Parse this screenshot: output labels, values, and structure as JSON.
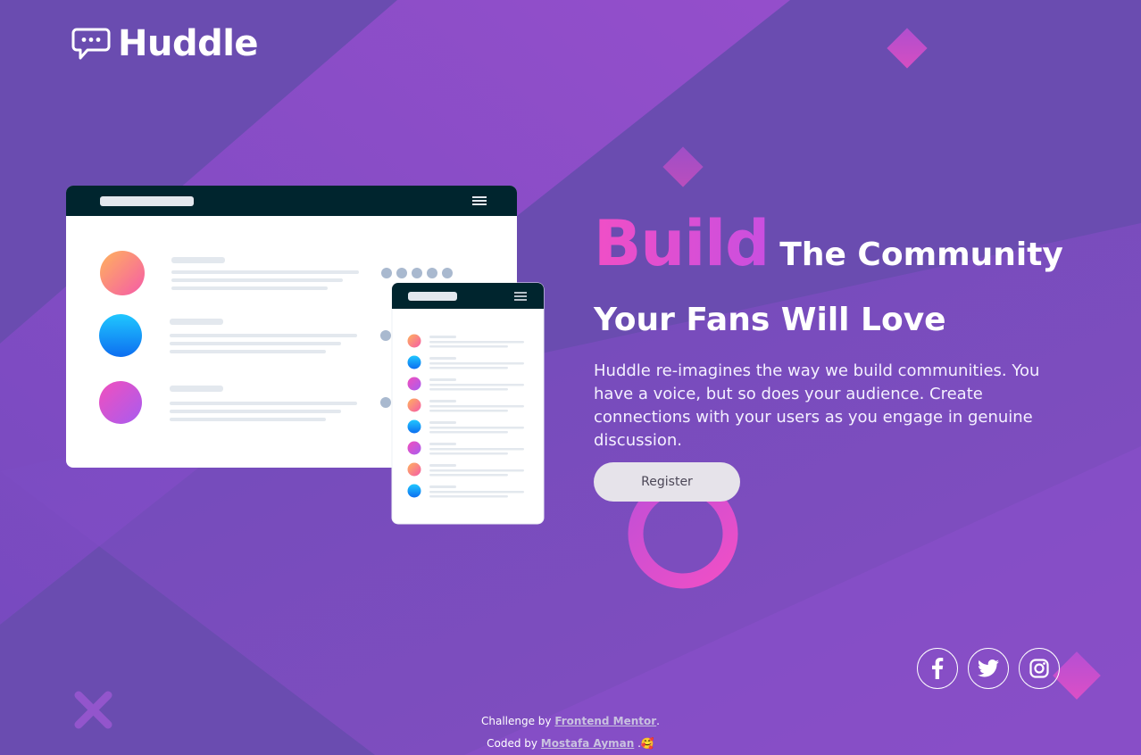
{
  "brand": {
    "name": "Huddle"
  },
  "hero": {
    "headline_accent": "Build",
    "headline_rest": "The Community",
    "headline_line2": "Your Fans Will Love",
    "description": "Huddle re-imagines the way we build communities. You have a voice, but so does your audience. Create connections with your users as you engage in genuine discussion.",
    "register_label": "Register"
  },
  "social": [
    {
      "icon": "facebook-icon"
    },
    {
      "icon": "twitter-icon"
    },
    {
      "icon": "instagram-icon"
    }
  ],
  "footer": {
    "line1_prefix": "Challenge by ",
    "line1_link": "Frontend Mentor",
    "line1_suffix": ".",
    "line2_prefix": "Coded by ",
    "line2_link": "Mostafa Ayman",
    "line2_suffix": " .",
    "emoji": "🥰"
  },
  "colors": {
    "background": "#6a4cb0",
    "accent_pink": "#f04fc6",
    "button_bg": "#e6e3ea",
    "mockup_header": "#00252e"
  }
}
